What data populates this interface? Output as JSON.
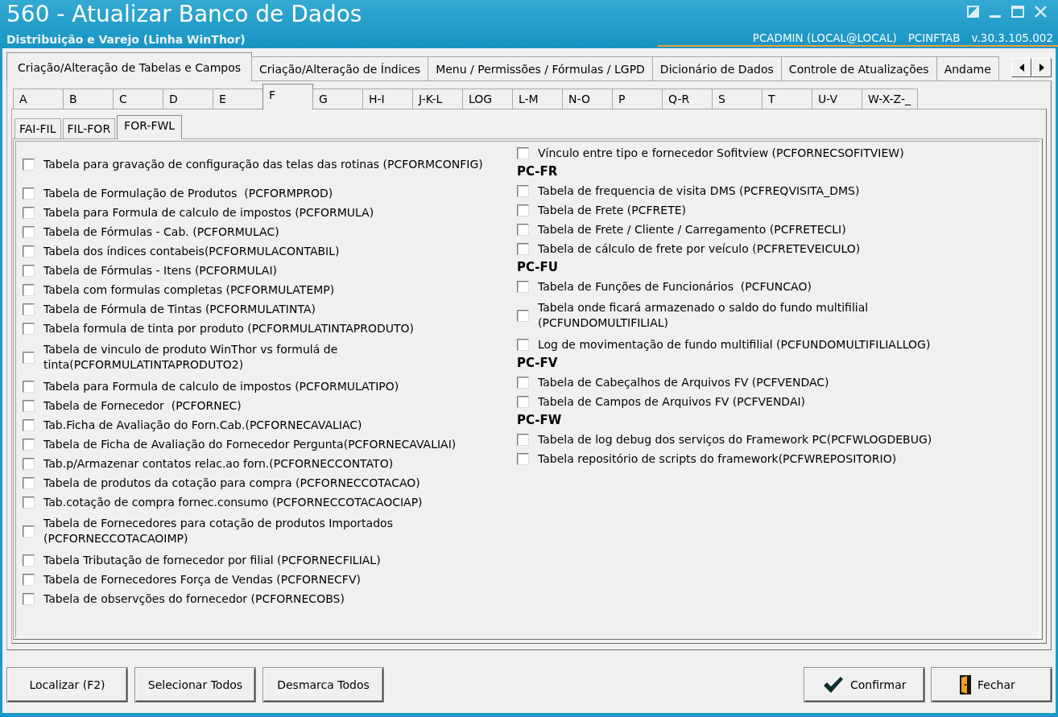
{
  "window": {
    "title": "560 - Atualizar Banco de Dados",
    "subtitle": "Distribuição e Varejo (Linha WinThor)",
    "user": "PCADMIN (LOCAL@LOCAL)",
    "module": "PCINFTAB",
    "version": "v.30.3.105.002"
  },
  "main_tabs": [
    {
      "label": "Criação/Alteração de Tabelas e Campos",
      "selected": true
    },
    {
      "label": "Criação/Alteração de Índices",
      "selected": false
    },
    {
      "label": "Menu / Permissões / Fórmulas / LGPD",
      "selected": false
    },
    {
      "label": "Dicionário de Dados",
      "selected": false
    },
    {
      "label": "Controle de Atualizações",
      "selected": false
    },
    {
      "label": "Andame",
      "selected": false
    }
  ],
  "letter_tabs": [
    {
      "label": "A",
      "selected": false
    },
    {
      "label": "B",
      "selected": false
    },
    {
      "label": "C",
      "selected": false
    },
    {
      "label": "D",
      "selected": false
    },
    {
      "label": "E",
      "selected": false
    },
    {
      "label": "F",
      "selected": true
    },
    {
      "label": "G",
      "selected": false
    },
    {
      "label": "H-I",
      "selected": false
    },
    {
      "label": "J-K-L",
      "selected": false
    },
    {
      "label": "LOG",
      "selected": false
    },
    {
      "label": "L-M",
      "selected": false
    },
    {
      "label": "N-O",
      "selected": false
    },
    {
      "label": "P",
      "selected": false
    },
    {
      "label": "Q-R",
      "selected": false
    },
    {
      "label": "S",
      "selected": false
    },
    {
      "label": "T",
      "selected": false
    },
    {
      "label": "U-V",
      "selected": false
    },
    {
      "label": "W-X-Z-_",
      "selected": false
    }
  ],
  "sub_tabs": [
    {
      "label": "FAI-FIL",
      "selected": false
    },
    {
      "label": "FIL-FOR",
      "selected": false
    },
    {
      "label": "FOR-FWL",
      "selected": true
    }
  ],
  "columns": [
    {
      "items": [
        {
          "kind": "checkbox",
          "label": "Tabela para gravação de configuração das telas das rotinas (PCFORMCONFIG)",
          "checked": false
        },
        {
          "kind": "checkbox",
          "label": "Tabela de Formulação de Produtos  (PCFORMPROD)",
          "checked": false
        },
        {
          "kind": "checkbox",
          "label": "Tabela para Formula de calculo de impostos (PCFORMULA)",
          "checked": false
        },
        {
          "kind": "checkbox",
          "label": "Tabela de Fórmulas - Cab. (PCFORMULAC)",
          "checked": false
        },
        {
          "kind": "checkbox",
          "label": "Tabela dos índices contabeis(PCFORMULACONTABIL)",
          "checked": false
        },
        {
          "kind": "checkbox",
          "label": "Tabela de Fórmulas - Itens (PCFORMULAI)",
          "checked": false
        },
        {
          "kind": "checkbox",
          "label": "Tabela com formulas completas (PCFORMULATEMP)",
          "checked": false
        },
        {
          "kind": "checkbox",
          "label": "Tabela de Fórmula de Tintas (PCFORMULATINTA)",
          "checked": false
        },
        {
          "kind": "checkbox",
          "label": "Tabela formula de tinta por produto (PCFORMULATINTAPRODUTO)",
          "checked": false
        },
        {
          "kind": "checkbox",
          "label": "Tabela de vinculo de produto WinThor vs formulá de\ntinta(PCFORMULATINTAPRODUTO2)",
          "checked": false
        },
        {
          "kind": "checkbox",
          "label": "Tabela para Formula de calculo de impostos (PCFORMULATIPO)",
          "checked": false
        },
        {
          "kind": "checkbox",
          "label": "Tabela de Fornecedor  (PCFORNEC)",
          "checked": false
        },
        {
          "kind": "checkbox",
          "label": "Tab.Ficha de Avaliação do Forn.Cab.(PCFORNECAVALIAC)",
          "checked": false
        },
        {
          "kind": "checkbox",
          "label": "Tabela de Ficha de Avaliação do Fornecedor Pergunta(PCFORNECAVALIAI)",
          "checked": false
        },
        {
          "kind": "checkbox",
          "label": "Tab.p/Armazenar contatos relac.ao forn.(PCFORNECCONTATO)",
          "checked": false
        },
        {
          "kind": "checkbox",
          "label": "Tabela de produtos da cotação para compra (PCFORNECCOTACAO)",
          "checked": false
        },
        {
          "kind": "checkbox",
          "label": "Tab.cotação de compra fornec.consumo (PCFORNECCOTACAOCIAP)",
          "checked": false
        },
        {
          "kind": "checkbox",
          "label": "Tabela de Fornecedores para cotação de produtos Importados\n(PCFORNECCOTACAOIMP)",
          "checked": false
        },
        {
          "kind": "checkbox",
          "label": "Tabela Tributação de fornecedor por filial (PCFORNECFILIAL)",
          "checked": false
        },
        {
          "kind": "checkbox",
          "label": "Tabela de Fornecedores Força de Vendas (PCFORNECFV)",
          "checked": false
        },
        {
          "kind": "checkbox",
          "label": "Tabela de observções do fornecedor (PCFORNECOBS)",
          "checked": false
        }
      ]
    },
    {
      "items": [
        {
          "kind": "checkbox",
          "label": "Vínculo entre tipo e fornecedor Sofitview (PCFORNECSOFITVIEW)",
          "checked": false
        },
        {
          "kind": "header",
          "label": "PC-FR"
        },
        {
          "kind": "checkbox",
          "label": "Tabela de frequencia de visita DMS (PCFREQVISITA_DMS)",
          "checked": false
        },
        {
          "kind": "checkbox",
          "label": "Tabela de Frete (PCFRETE)",
          "checked": false
        },
        {
          "kind": "checkbox",
          "label": "Tabela de Frete / Cliente / Carregamento (PCFRETECLI)",
          "checked": false
        },
        {
          "kind": "checkbox",
          "label": "Tabela de cálculo de frete por veículo (PCFRETEVEICULO)",
          "checked": false
        },
        {
          "kind": "header",
          "label": "PC-FU"
        },
        {
          "kind": "checkbox",
          "label": "Tabela de Funções de Funcionários  (PCFUNCAO)",
          "checked": false
        },
        {
          "kind": "checkbox",
          "label": "Tabela onde ficará armazenado o saldo do fundo multifilial\n(PCFUNDOMULTIFILIAL)",
          "checked": false
        },
        {
          "kind": "checkbox",
          "label": "Log de movimentação de fundo multifilial (PCFUNDOMULTIFILIALLOG)",
          "checked": false
        },
        {
          "kind": "header",
          "label": "PC-FV"
        },
        {
          "kind": "checkbox",
          "label": "Tabela de Cabeçalhos de Arquivos FV (PCFVENDAC)",
          "checked": false
        },
        {
          "kind": "checkbox",
          "label": "Tabela de Campos de Arquivos FV (PCFVENDAI)",
          "checked": false
        },
        {
          "kind": "header",
          "label": "PC-FW"
        },
        {
          "kind": "checkbox",
          "label": "Tabela de log debug dos serviços do Framework PC(PCFWLOGDEBUG)",
          "checked": false
        },
        {
          "kind": "checkbox",
          "label": "Tabela repositório de scripts do framework(PCFWREPOSITORIO)",
          "checked": false
        }
      ]
    }
  ],
  "left_buttons": [
    {
      "kind": "plain",
      "label": "Localizar (F2)"
    },
    {
      "kind": "plain",
      "label": "Selecionar Todos"
    },
    {
      "kind": "plain",
      "label": "Desmarca Todos"
    }
  ],
  "right_buttons": [
    {
      "kind": "confirm",
      "label": "Confirmar"
    },
    {
      "kind": "close",
      "label": "Fechar"
    }
  ]
}
